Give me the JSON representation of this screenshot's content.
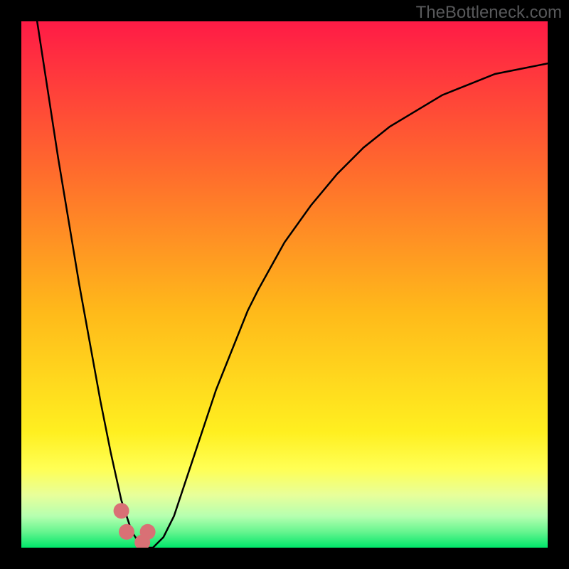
{
  "watermark": "TheBottleneck.com",
  "colors": {
    "frame": "#000000",
    "watermark": "#58595b",
    "curve": "#000000",
    "marker": "#d97075",
    "gradient_top": "#ff1b46",
    "gradient_mid1": "#ff7a2a",
    "gradient_mid2": "#ffd21a",
    "gradient_yellow": "#ffff54",
    "gradient_pale": "#ccffb0",
    "gradient_green": "#00e66a"
  },
  "chart_data": {
    "type": "line",
    "title": "",
    "xlabel": "",
    "ylabel": "",
    "xlim": [
      0,
      100
    ],
    "ylim": [
      0,
      100
    ],
    "x": [
      3,
      5,
      7,
      9,
      11,
      13,
      15,
      17,
      19,
      21,
      23,
      25,
      27,
      29,
      31,
      33,
      35,
      37,
      39,
      41,
      43,
      45,
      50,
      55,
      60,
      65,
      70,
      75,
      80,
      85,
      90,
      95,
      100
    ],
    "values": [
      100,
      87,
      74,
      62,
      50,
      39,
      28,
      18,
      9,
      3,
      0,
      0,
      2,
      6,
      12,
      18,
      24,
      30,
      35,
      40,
      45,
      49,
      58,
      65,
      71,
      76,
      80,
      83,
      86,
      88,
      90,
      91,
      92
    ],
    "markers_x": [
      19,
      20,
      23,
      24
    ],
    "markers_y": [
      7,
      3,
      1,
      3
    ],
    "background_bands": [
      {
        "from_y": 100,
        "to_y": 18,
        "color": "red-orange-gradient"
      },
      {
        "from_y": 18,
        "to_y": 10,
        "color": "yellow"
      },
      {
        "from_y": 10,
        "to_y": 3,
        "color": "pale-green"
      },
      {
        "from_y": 3,
        "to_y": 0,
        "color": "green"
      }
    ]
  }
}
